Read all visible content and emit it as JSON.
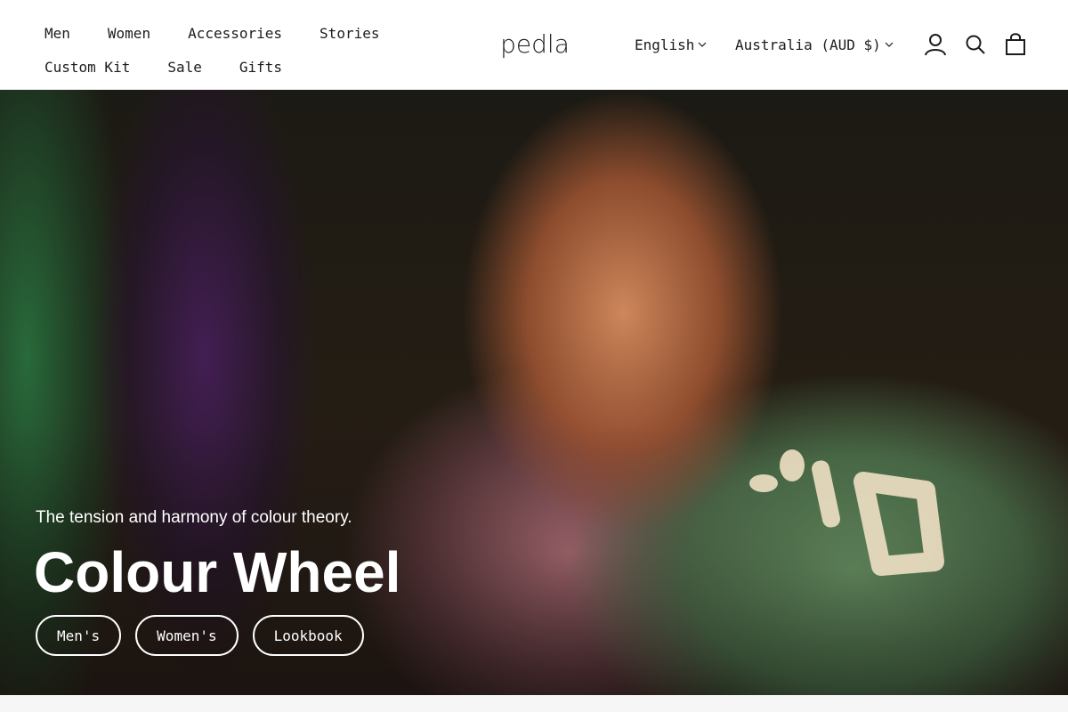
{
  "nav": {
    "row1": [
      "Men",
      "Women",
      "Accessories",
      "Stories"
    ],
    "row2": [
      "Custom Kit",
      "Sale",
      "Gifts"
    ]
  },
  "brand": {
    "logo_text": "pedla"
  },
  "header": {
    "language": "English",
    "country": "Australia (AUD $)",
    "icons": [
      "account-icon",
      "search-icon",
      "cart-icon"
    ]
  },
  "hero": {
    "subtitle": "The tension and harmony of colour theory.",
    "title": "Colour Wheel",
    "buttons": [
      "Men's",
      "Women's",
      "Lookbook"
    ]
  },
  "colors": {
    "header_bg": "#ffffff",
    "text": "#1c1c1c",
    "hero_text": "#ffffff"
  }
}
